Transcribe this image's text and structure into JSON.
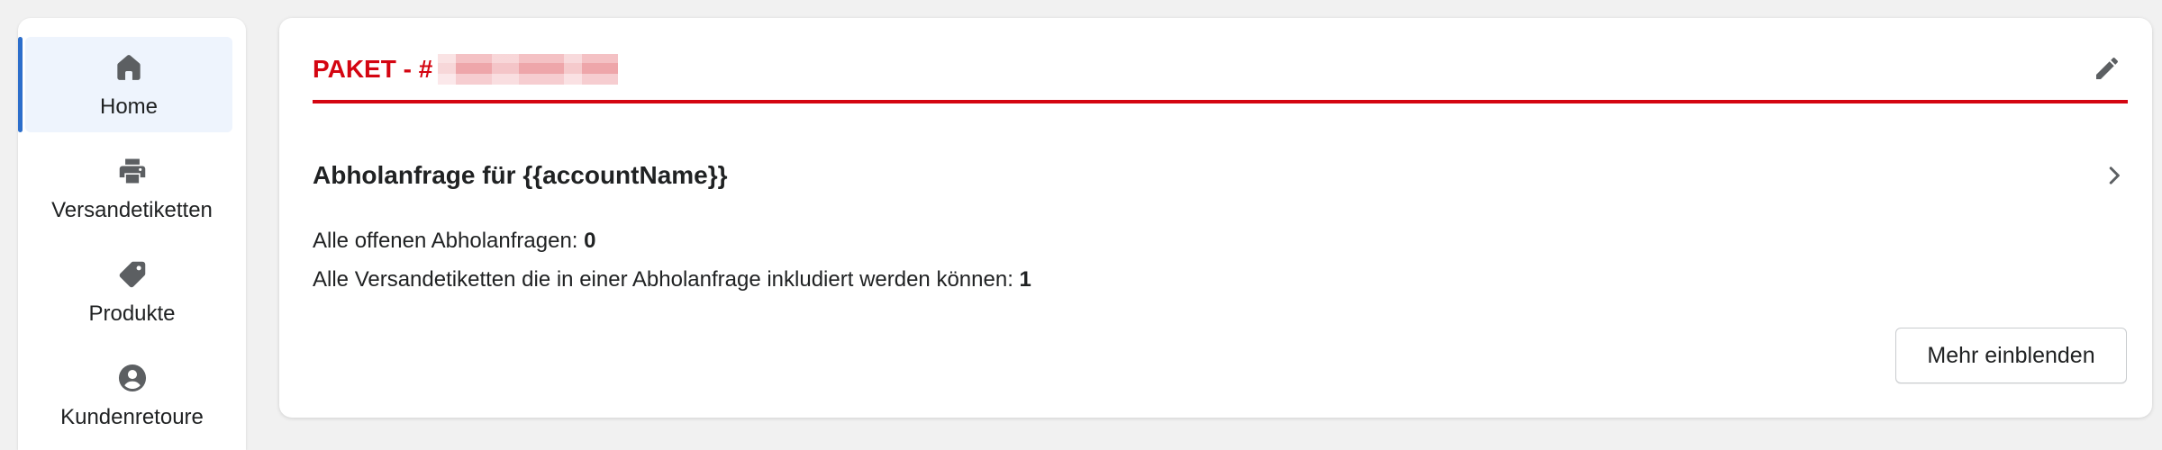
{
  "sidebar": {
    "items": [
      {
        "label": "Home",
        "icon": "home-icon",
        "active": true
      },
      {
        "label": "Versandetiketten",
        "icon": "printer-icon",
        "active": false
      },
      {
        "label": "Produkte",
        "icon": "tag-icon",
        "active": false
      },
      {
        "label": "Kundenretoure",
        "icon": "user-circle-icon",
        "active": false
      }
    ]
  },
  "card": {
    "title_prefix": "PAKET - #",
    "edit_icon": "pencil-icon",
    "pickup_title": "Abholanfrage für {{accountName}}",
    "chevron_icon": "chevron-right-icon",
    "stats": [
      {
        "label": "Alle offenen Abholanfragen: ",
        "value": "0"
      },
      {
        "label": "Alle Versandetiketten die in einer Abholanfrage inkludiert werden können: ",
        "value": "1"
      }
    ],
    "more_button": "Mehr einblenden"
  },
  "colors": {
    "brand_red": "#d40511",
    "active_accent": "#2c6ecb",
    "active_bg": "#eef4fd",
    "icon_gray": "#5c5f62"
  }
}
